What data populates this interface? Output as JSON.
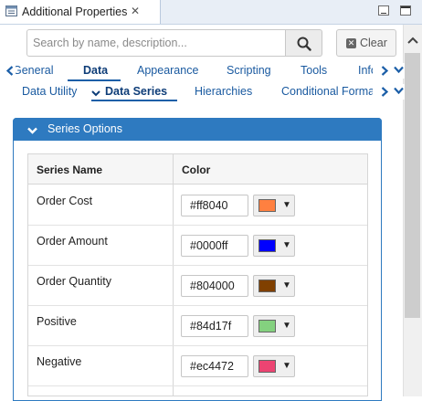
{
  "view": {
    "tab_title": "Additional Properties",
    "icons": {
      "view": "properties-view-icon",
      "close": "close-icon",
      "minimize": "minimize-icon",
      "maximize": "maximize-icon"
    }
  },
  "search": {
    "placeholder": "Search by name, description...",
    "value": "",
    "clear_label": "Clear"
  },
  "tabs_row1": [
    {
      "label": "General"
    },
    {
      "label": "Data",
      "active": true
    },
    {
      "label": "Appearance"
    },
    {
      "label": "Scripting"
    },
    {
      "label": "Tools"
    },
    {
      "label": "Info"
    }
  ],
  "tabs_row2": [
    {
      "label": "Data Utility"
    },
    {
      "label": "Data Series",
      "active": true
    },
    {
      "label": "Hierarchies"
    },
    {
      "label": "Conditional Formatting"
    }
  ],
  "panel": {
    "title": "Series Options",
    "header_color": "#2e7ac0"
  },
  "table": {
    "columns": [
      "Series Name",
      "Color"
    ],
    "rows": [
      {
        "name": "Order Cost",
        "hex": "#ff8040",
        "swatch": "#ff8040"
      },
      {
        "name": "Order Amount",
        "hex": "#0000ff",
        "swatch": "#0000ff"
      },
      {
        "name": "Order Quantity",
        "hex": "#804000",
        "swatch": "#804000"
      },
      {
        "name": "Positive",
        "hex": "#84d17f",
        "swatch": "#84d17f"
      },
      {
        "name": "Negative",
        "hex": "#ec4472",
        "swatch": "#ec4472"
      }
    ]
  },
  "colors": {
    "accent": "#2e7ac0",
    "link": "#1a5aa0"
  }
}
